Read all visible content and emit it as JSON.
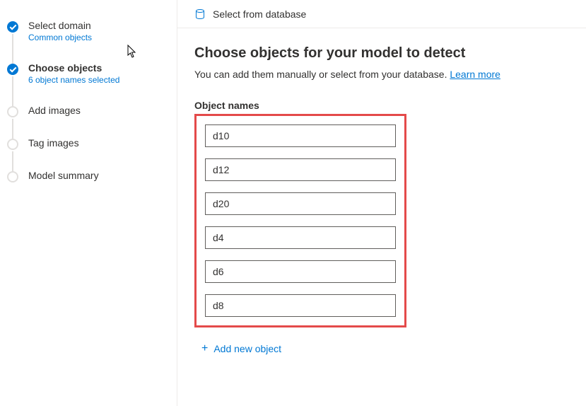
{
  "sidebar": {
    "steps": [
      {
        "title": "Select domain",
        "subtitle": "Common objects",
        "state": "completed"
      },
      {
        "title": "Choose objects",
        "subtitle": "6 object names selected",
        "state": "current"
      },
      {
        "title": "Add images",
        "subtitle": "",
        "state": "pending"
      },
      {
        "title": "Tag images",
        "subtitle": "",
        "state": "pending"
      },
      {
        "title": "Model summary",
        "subtitle": "",
        "state": "pending"
      }
    ]
  },
  "topbar": {
    "select_from_db_label": "Select from database"
  },
  "main": {
    "heading": "Choose objects for your model to detect",
    "subtext_prefix": "You can add them manually or select from your database. ",
    "learn_more_label": "Learn more",
    "object_names_label": "Object names",
    "objects": [
      "d10",
      "d12",
      "d20",
      "d4",
      "d6",
      "d8"
    ],
    "add_new_label": "Add new object"
  }
}
